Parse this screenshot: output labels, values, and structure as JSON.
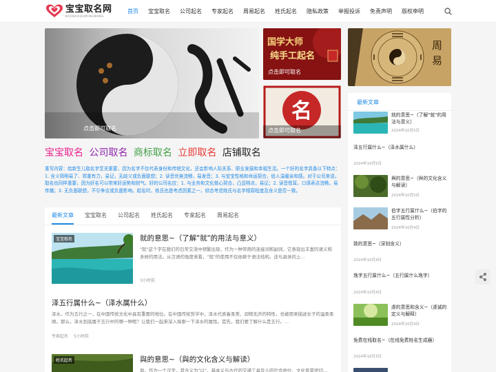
{
  "header": {
    "logo_title": "宝宝取名网",
    "logo_sub": "BAOBAOQUMINGWANG",
    "nav": [
      "首页",
      "宝宝取名",
      "公司起名",
      "专家起名",
      "周易起名",
      "姓氏起名",
      "隐私政策",
      "举报投诉",
      "免责声明",
      "版权申明"
    ]
  },
  "hero": {
    "main_caption": "点击即可取名",
    "card1_text": "国学大师 纯手工起名",
    "card1_caption": "点击即可取名",
    "card2_char": "名",
    "card2_caption": "点击即可取名",
    "banner_text": "周易"
  },
  "brands": [
    {
      "label": "宝宝取名",
      "color": "#e91e8c"
    },
    {
      "label": "公司取名",
      "color": "#8e24aa"
    },
    {
      "label": "商标取名",
      "color": "#43a047"
    },
    {
      "label": "立即取名",
      "color": "#e53935"
    },
    {
      "label": "店铺取名",
      "color": "#222222"
    }
  ],
  "intro": "重写内容：给新生儿取名字至关重要，因为名字不仅代表身份和传统文化，还会影响人际关系、职业发展和幸福生活。一个好的名字具备以下特点：1. 含义简明易了、郑重有力，易记，无歧义或负面联想；2. 读音优美流畅，易发音；3. 与宝宝性格和命运契合，给人温暖亲和感。对于公司来说，取名也同样重要，因为好名可以带来好运势和财气。好的公司名应：1. 与业务和文化核心契合，凸显特点，易记；2. 读音悦耳，口语表达流畅，易传播；3. 无负面联想，不引争议或负面影响。起名时，姓氏也是考虑因素之一，综合考虑姓氏与名字相容程度及含义是否一致。",
  "tabs": [
    "最新文章",
    "宝宝取名",
    "公司起名",
    "姓氏起名",
    "专家起名",
    "周易起名"
  ],
  "posts": [
    {
      "badge": "宝宝取名",
      "title": "就的意思~（了解\"就\"的用法与意义）",
      "excerpt": "\"就\"这个字在我们的日常交流中频繁出现，作为一种常用的连接词和副词，它表现出丰富的语义和多样的用法。从汉语的角度来看，\"就\"的使用不仅依赖于语法结构，还与具体的上...",
      "meta": "3小时前"
    },
    {
      "title": "泽五行属什么~（泽水属什么）",
      "excerpt": "泽水，作为五行之一，在中国传统文化中具有重要的地位。在中国传统哲学中，泽水代表着柔美、润物无声的特性，也被用来描述女子的温柔柔顺。那么，泽水到底属于五行中的哪一种呢？让我们一起来深入探索一下泽水的属性。首先，我们要了解什么是五行。...",
      "meta_cat": "专家起名",
      "meta": "5小时前"
    },
    {
      "badge": "姓氏起名",
      "title": "與的意思~（與的文化含义与解读）",
      "excerpt": "與，作为一个汉字，其含义为\"以\"，基本义与古代的交通工具及人的社会地位、文化背景密切..."
    }
  ],
  "sidebar": {
    "heading": "最新文章",
    "items": [
      {
        "title": "就的意思~（了解\"就\"的用法与意义）",
        "date": "2024年10月5日"
      },
      {
        "title": "泽五行属什么~（泽水属什么）",
        "date": "2024年10月5日"
      },
      {
        "title": "與的意思~（與的文化含义与解读）",
        "date": "2024年10月5日"
      },
      {
        "title": "伯字五行属什么~（伯字的五行属性分析）",
        "date": "2024年10月4日"
      },
      {
        "title": "致的意思~（深刻含义）",
        "date": "2024年10月4日"
      },
      {
        "title": "逸字五行属什么~（五行属什么逸字）",
        "date": "2024年10月4日"
      },
      {
        "title": "虔的意思和含义~（虔诚的定义与解释）",
        "date": "2024年10月4日"
      },
      {
        "title": "免费在线取名~（在线免费姓名生成器）",
        "date": "2024年10月3日"
      },
      {
        "title": "",
        "date": ""
      }
    ]
  }
}
